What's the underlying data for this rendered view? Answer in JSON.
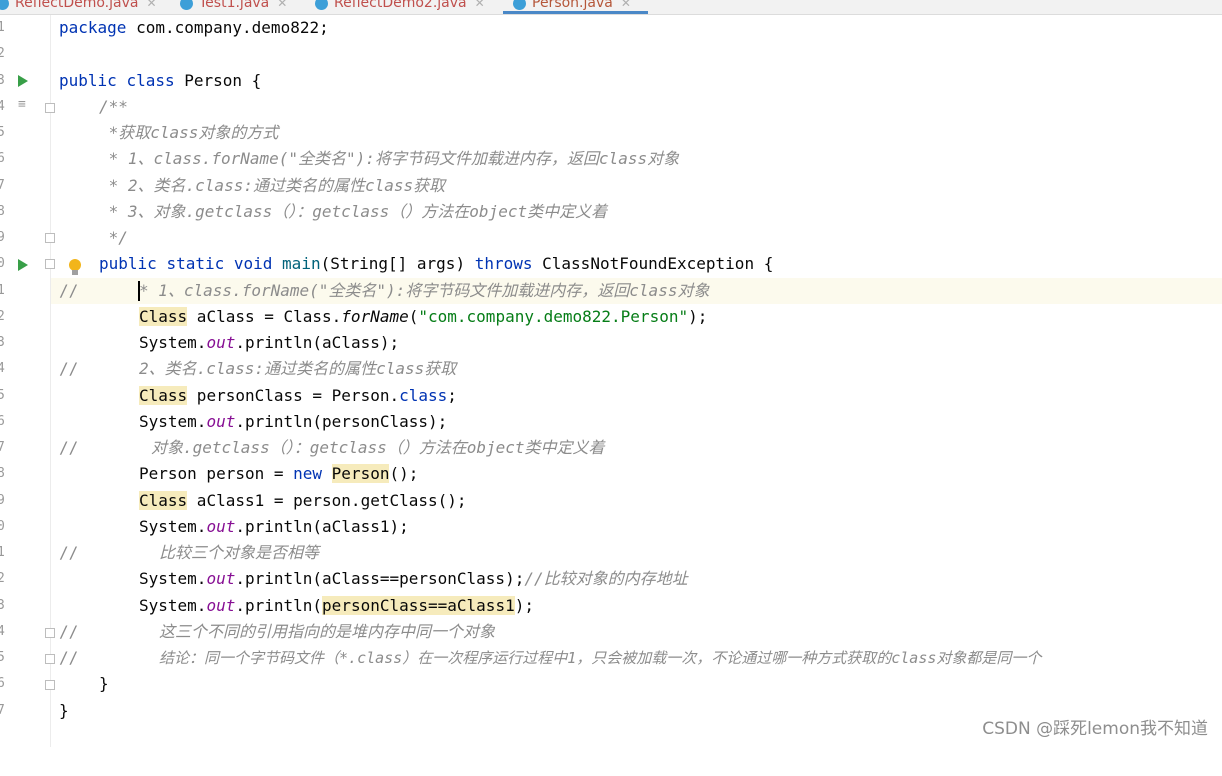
{
  "tabs": [
    {
      "label": "ReflectDemo.java"
    },
    {
      "label": "Test1.java"
    },
    {
      "label": "ReflectDemo2.java"
    },
    {
      "label": "Person.java"
    }
  ],
  "active_tab": "Person.java",
  "line_numbers": [
    "1",
    "2",
    "3",
    "4",
    "5",
    "6",
    "7",
    "8",
    "9",
    "0",
    "1",
    "2",
    "3",
    "4",
    "5",
    "6",
    "7",
    "8",
    "9",
    "0",
    "1",
    "2",
    "3",
    "4",
    "5",
    "6",
    "7"
  ],
  "code": {
    "l1": {
      "kw": "package",
      "rest": " com.company.demo822;"
    },
    "l3": {
      "kw1": "public",
      "kw2": "class",
      "rest": " Person {"
    },
    "l4": "/**",
    "l5": " *获取class对象的方式",
    "l6": " * 1、class.forName(\"全类名\"):将字节码文件加载进内存，返回class对象",
    "l7": " * 2、类名.class:通过类名的属性class获取",
    "l8": " * 3、对象.getclass（）：getclass（）方法在object类中定义着",
    "l9": " */",
    "l10": {
      "kw1": "public",
      "kw2": "static",
      "kw3": "void",
      "name": "main",
      "args": "(String[] args)",
      "throws": "throws",
      "rest": " ClassNotFoundException {"
    },
    "l11": {
      "prefix": "//",
      "text": "* 1、class.forName(\"全类名\"):将字节码文件加载进内存，返回class对象"
    },
    "l12": {
      "type": "Class",
      "mid": " aClass = Class.",
      "method": "forName",
      "open": "(",
      "str": "\"com.company.demo822.Person\"",
      "close": ");"
    },
    "l13": {
      "a": "System.",
      "field": "out",
      "b": ".println(aClass);"
    },
    "l14": {
      "prefix": "//",
      "text": "2、类名.class:通过类名的属性class获取"
    },
    "l15": {
      "type": "Class",
      "mid": " personClass = Person.",
      "kw": "class",
      "end": ";"
    },
    "l16": {
      "a": "System.",
      "field": "out",
      "b": ".println(personClass);"
    },
    "l17": {
      "prefix": "//",
      "text": "对象.getclass（）：getclass（）方法在object类中定义着"
    },
    "l18": {
      "a": "Person person = ",
      "kw": "new",
      "sp": " ",
      "type": "Person",
      "end": "();"
    },
    "l19": {
      "type": "Class",
      "rest": " aClass1 = person.getClass();"
    },
    "l20": {
      "a": "System.",
      "field": "out",
      "b": ".println(aClass1);"
    },
    "l21": {
      "prefix": "//",
      "text": "比较三个对象是否相等"
    },
    "l22": {
      "a": "System.",
      "field": "out",
      "b": ".println(aClass==personClass);",
      "comment": "//比较对象的内存地址"
    },
    "l23": {
      "a": "System.",
      "field": "out",
      "b": ".println(",
      "hl": "personClass==aClass1",
      "end": ");"
    },
    "l24": {
      "prefix": "//",
      "text": "这三个不同的引用指向的是堆内存中同一个对象"
    },
    "l25": {
      "prefix": "//",
      "text": "结论：同一个字节码文件（*.class）在一次程序运行过程中1，只会被加载一次，不论通过哪一种方式获取的class对象都是同一个"
    },
    "l26": "}",
    "l27": "}"
  },
  "watermark": "CSDN @踩死lemon我不知道"
}
